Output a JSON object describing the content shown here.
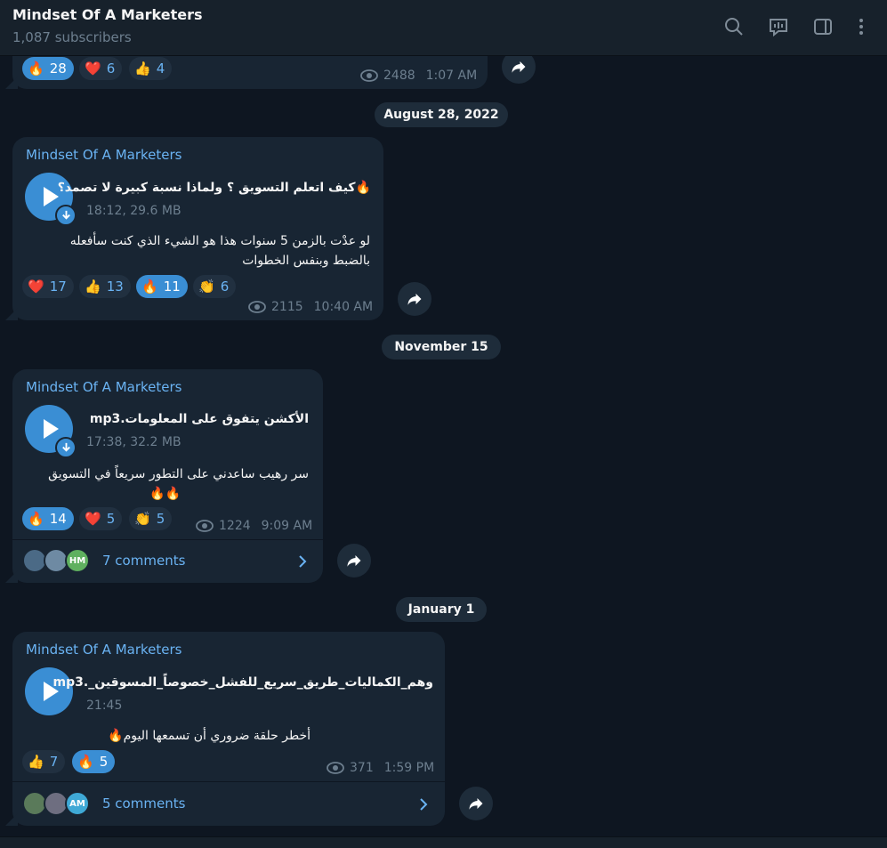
{
  "header": {
    "title": "Mindset Of A Marketers",
    "subtitle": "1,087 subscribers",
    "icons": [
      "search-icon",
      "voice-chat-icon",
      "sidebar-icon",
      "more-icon"
    ]
  },
  "top_message": {
    "reactions": [
      {
        "emoji": "🔥",
        "count": "28",
        "selected": true
      },
      {
        "emoji": "❤️",
        "count": "6",
        "selected": false
      },
      {
        "emoji": "👍",
        "count": "4",
        "selected": false
      }
    ],
    "views": "2488",
    "time": "1:07 AM"
  },
  "dates": [
    "August 28, 2022",
    "November 15",
    "January 1"
  ],
  "messages": [
    {
      "sender": "Mindset Of A Marketers",
      "file_title": "🔥كيف اتعلم التسويق ؟ ولماذا نسبة كبيرة لا تصمد؟",
      "file_meta": "18:12, 29.6 MB",
      "caption_lines": [
        "لو عدْت بالزمن 5 سنوات هذا هو الشيء الذي كنت سأفعله",
        "بالضبط وبنفس الخطوات"
      ],
      "reactions": [
        {
          "emoji": "❤️",
          "count": "17",
          "selected": false
        },
        {
          "emoji": "👍",
          "count": "13",
          "selected": false
        },
        {
          "emoji": "🔥",
          "count": "11",
          "selected": true
        },
        {
          "emoji": "👏",
          "count": "6",
          "selected": false
        }
      ],
      "views": "2115",
      "time": "10:40 AM"
    },
    {
      "sender": "Mindset Of A Marketers",
      "file_title": "الأكشن يتفوق على المعلومات.mp3",
      "file_meta": "17:38, 32.2 MB",
      "caption_lines": [
        "سر رهيب ساعدني على التطور سريعاً في التسويق",
        "🔥🔥"
      ],
      "reactions": [
        {
          "emoji": "🔥",
          "count": "14",
          "selected": true
        },
        {
          "emoji": "❤️",
          "count": "5",
          "selected": false
        },
        {
          "emoji": "👏",
          "count": "5",
          "selected": false
        }
      ],
      "views": "1224",
      "time": "9:09 AM",
      "comments": "7 comments",
      "commenter_initials": "HM"
    },
    {
      "sender": "Mindset Of A Marketers",
      "file_title": "وهم_الكماليات_طريق_سريع_للفشل_خصوصاً_المسوقين_.mp3",
      "file_meta": "21:45",
      "caption_lines": [
        "أخطر حلقة ضروري أن تسمعها اليوم🔥"
      ],
      "reactions": [
        {
          "emoji": "👍",
          "count": "7",
          "selected": false
        },
        {
          "emoji": "🔥",
          "count": "5",
          "selected": true
        }
      ],
      "views": "371",
      "time": "1:59 PM",
      "comments": "5 comments",
      "commenter_initials": "AM"
    }
  ],
  "colors": {
    "background": "#0e1621",
    "bubble": "#182533",
    "accent": "#3a8ed4",
    "link": "#6ab3f3",
    "muted": "#6d7f8f"
  }
}
